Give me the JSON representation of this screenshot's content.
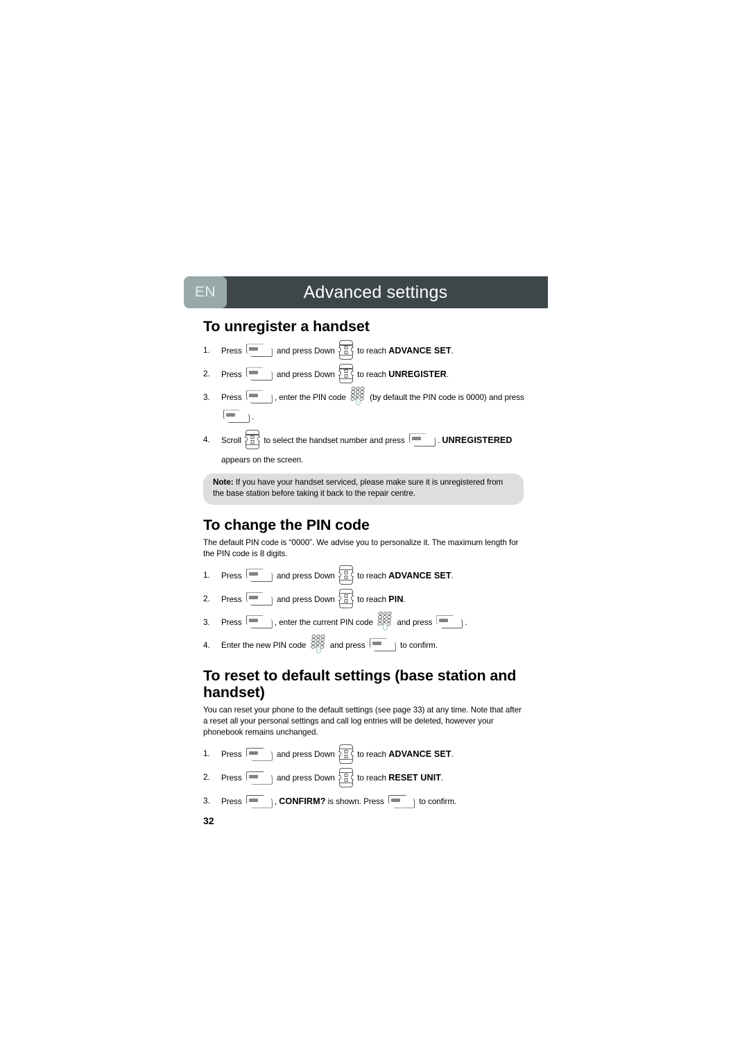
{
  "header": {
    "language_tab": "EN",
    "title": "Advanced settings",
    "tab_color": "#97a9a8",
    "bar_color": "#3d4749"
  },
  "sections": [
    {
      "id": "unregister-handset",
      "heading": "To unregister a handset",
      "steps": [
        {
          "number": "1.",
          "parts": [
            {
              "type": "text",
              "value": "Press "
            },
            {
              "type": "icon",
              "name": "menu-softkey-icon"
            },
            {
              "type": "text",
              "value": " and press Down "
            },
            {
              "type": "icon",
              "name": "navigation-down-key-icon"
            },
            {
              "type": "text",
              "value": " to reach "
            },
            {
              "type": "bold",
              "value": "ADVANCE SET"
            },
            {
              "type": "text",
              "value": "."
            }
          ]
        },
        {
          "number": "2.",
          "parts": [
            {
              "type": "text",
              "value": "Press "
            },
            {
              "type": "icon",
              "name": "menu-softkey-icon"
            },
            {
              "type": "text",
              "value": " and press Down "
            },
            {
              "type": "icon",
              "name": "navigation-down-key-icon"
            },
            {
              "type": "text",
              "value": " to reach "
            },
            {
              "type": "bold",
              "value": "UNREGISTER"
            },
            {
              "type": "text",
              "value": "."
            }
          ]
        },
        {
          "number": "3.",
          "parts": [
            {
              "type": "text",
              "value": "Press "
            },
            {
              "type": "icon",
              "name": "menu-softkey-icon"
            },
            {
              "type": "text",
              "value": ", enter the PIN code "
            },
            {
              "type": "icon",
              "name": "keypad-icon"
            },
            {
              "type": "text",
              "value": " (by default the PIN code is 0000) and press"
            },
            {
              "type": "linebreak"
            },
            {
              "type": "icon",
              "name": "menu-softkey-icon"
            },
            {
              "type": "text",
              "value": "."
            }
          ]
        },
        {
          "number": "4.",
          "parts": [
            {
              "type": "text",
              "value": "Scroll "
            },
            {
              "type": "icon",
              "name": "navigation-down-key-icon"
            },
            {
              "type": "text",
              "value": " to select the handset number and press "
            },
            {
              "type": "icon",
              "name": "menu-softkey-icon"
            },
            {
              "type": "text",
              "value": ". "
            },
            {
              "type": "bold",
              "value": "UNREGISTERED"
            },
            {
              "type": "linebreak"
            },
            {
              "type": "text",
              "value": "appears on the screen."
            }
          ]
        }
      ],
      "note": {
        "label": "Note:",
        "text": " If you have your handset serviced, please make sure it is unregistered from the base station before taking it back to the repair centre.",
        "background": "#dcdfde"
      }
    },
    {
      "id": "change-pin-code",
      "heading": "To change the PIN code",
      "intro": "The default PIN code is “0000”. We advise you to personalize it. The maximum length for the PIN code is 8 digits.",
      "steps": [
        {
          "number": "1.",
          "parts": [
            {
              "type": "text",
              "value": "Press "
            },
            {
              "type": "icon",
              "name": "menu-softkey-icon"
            },
            {
              "type": "text",
              "value": " and press Down "
            },
            {
              "type": "icon",
              "name": "navigation-down-key-icon"
            },
            {
              "type": "text",
              "value": " to reach "
            },
            {
              "type": "bold",
              "value": "ADVANCE SET"
            },
            {
              "type": "text",
              "value": "."
            }
          ]
        },
        {
          "number": "2.",
          "parts": [
            {
              "type": "text",
              "value": "Press "
            },
            {
              "type": "icon",
              "name": "menu-softkey-icon"
            },
            {
              "type": "text",
              "value": " and press Down "
            },
            {
              "type": "icon",
              "name": "navigation-down-key-icon"
            },
            {
              "type": "text",
              "value": " to reach "
            },
            {
              "type": "bold",
              "value": "PIN"
            },
            {
              "type": "text",
              "value": "."
            }
          ]
        },
        {
          "number": "3.",
          "parts": [
            {
              "type": "text",
              "value": "Press "
            },
            {
              "type": "icon",
              "name": "menu-softkey-icon"
            },
            {
              "type": "text",
              "value": ", enter the current PIN code "
            },
            {
              "type": "icon",
              "name": "keypad-icon"
            },
            {
              "type": "text",
              "value": " and press "
            },
            {
              "type": "icon",
              "name": "menu-softkey-icon"
            },
            {
              "type": "text",
              "value": "."
            }
          ]
        },
        {
          "number": "4.",
          "parts": [
            {
              "type": "text",
              "value": "Enter the new PIN code "
            },
            {
              "type": "icon",
              "name": "keypad-icon"
            },
            {
              "type": "text",
              "value": " and press "
            },
            {
              "type": "icon",
              "name": "menu-softkey-icon"
            },
            {
              "type": "text",
              "value": " to confirm."
            }
          ]
        }
      ]
    },
    {
      "id": "reset-default-settings",
      "heading": "To reset to default settings (base station and handset)",
      "intro": "You can reset your phone to the default settings (see page 33) at any time. Note that after a reset all your personal settings and call log entries will be deleted, however your phonebook remains unchanged.",
      "steps": [
        {
          "number": "1.",
          "parts": [
            {
              "type": "text",
              "value": "Press "
            },
            {
              "type": "icon",
              "name": "menu-softkey-icon"
            },
            {
              "type": "text",
              "value": " and press Down "
            },
            {
              "type": "icon",
              "name": "navigation-down-key-icon"
            },
            {
              "type": "text",
              "value": " to reach "
            },
            {
              "type": "bold",
              "value": "ADVANCE SET"
            },
            {
              "type": "text",
              "value": "."
            }
          ]
        },
        {
          "number": "2.",
          "parts": [
            {
              "type": "text",
              "value": "Press "
            },
            {
              "type": "icon",
              "name": "menu-softkey-icon"
            },
            {
              "type": "text",
              "value": " and press Down "
            },
            {
              "type": "icon",
              "name": "navigation-down-key-icon"
            },
            {
              "type": "text",
              "value": " to reach "
            },
            {
              "type": "bold",
              "value": "RESET UNIT"
            },
            {
              "type": "text",
              "value": "."
            }
          ]
        },
        {
          "number": "3.",
          "parts": [
            {
              "type": "text",
              "value": "Press "
            },
            {
              "type": "icon",
              "name": "menu-softkey-icon"
            },
            {
              "type": "text",
              "value": ", "
            },
            {
              "type": "bold",
              "value": "CONFIRM?"
            },
            {
              "type": "text",
              "value": " is shown. Press "
            },
            {
              "type": "icon",
              "name": "menu-softkey-icon"
            },
            {
              "type": "text",
              "value": " to confirm."
            }
          ]
        }
      ]
    }
  ],
  "footer": {
    "page_number": "32"
  }
}
